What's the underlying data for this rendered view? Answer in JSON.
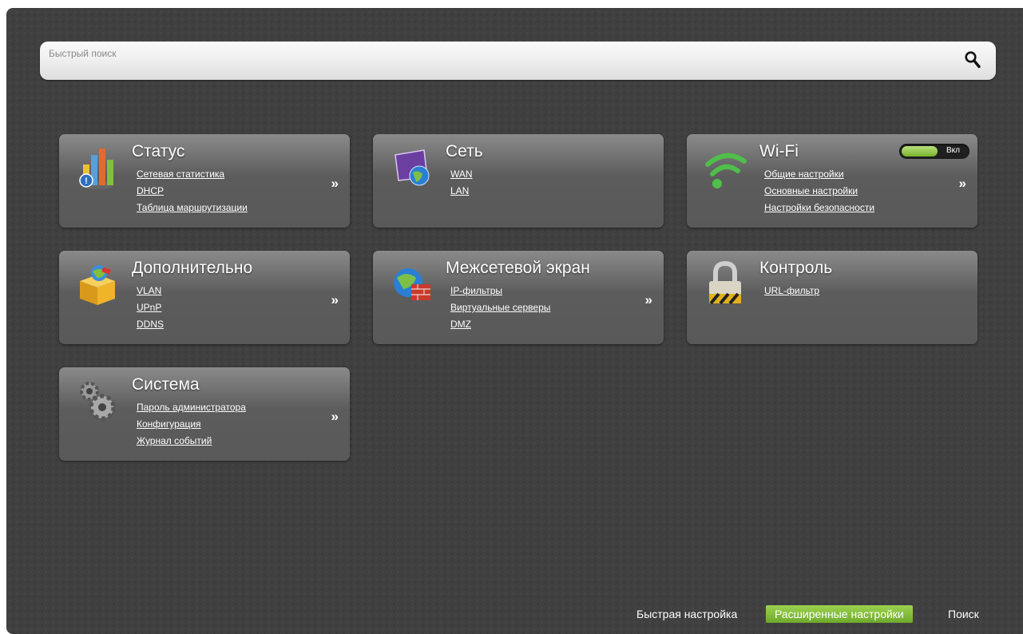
{
  "search": {
    "placeholder": "Быстрый поиск"
  },
  "tiles": {
    "status": {
      "title": "Статус",
      "links": [
        "Сетевая статистика",
        "DHCP",
        "Таблица маршрутизации"
      ],
      "more": "»"
    },
    "network": {
      "title": "Сеть",
      "links": [
        "WAN",
        "LAN"
      ]
    },
    "wifi": {
      "title": "Wi-Fi",
      "toggle_label": "Вкл",
      "links": [
        "Общие настройки",
        "Основные настройки",
        "Настройки безопасности"
      ],
      "more": "»"
    },
    "advanced": {
      "title": "Дополнительно",
      "links": [
        "VLAN",
        "UPnP",
        "DDNS"
      ],
      "more": "»"
    },
    "firewall": {
      "title": "Межсетевой экран",
      "links": [
        "IP-фильтры",
        "Виртуальные серверы",
        "DMZ"
      ],
      "more": "»"
    },
    "control": {
      "title": "Контроль",
      "links": [
        "URL-фильтр"
      ]
    },
    "system": {
      "title": "Система",
      "links": [
        "Пароль администратора",
        "Конфигурация",
        "Журнал событий"
      ],
      "more": "»"
    }
  },
  "footer": {
    "quick_setup": "Быстрая настройка",
    "advanced_settings": "Расширенные настройки",
    "search": "Поиск"
  },
  "colors": {
    "background": "#404040",
    "accent_green": "#8cc63f",
    "text": "#ffffff"
  }
}
